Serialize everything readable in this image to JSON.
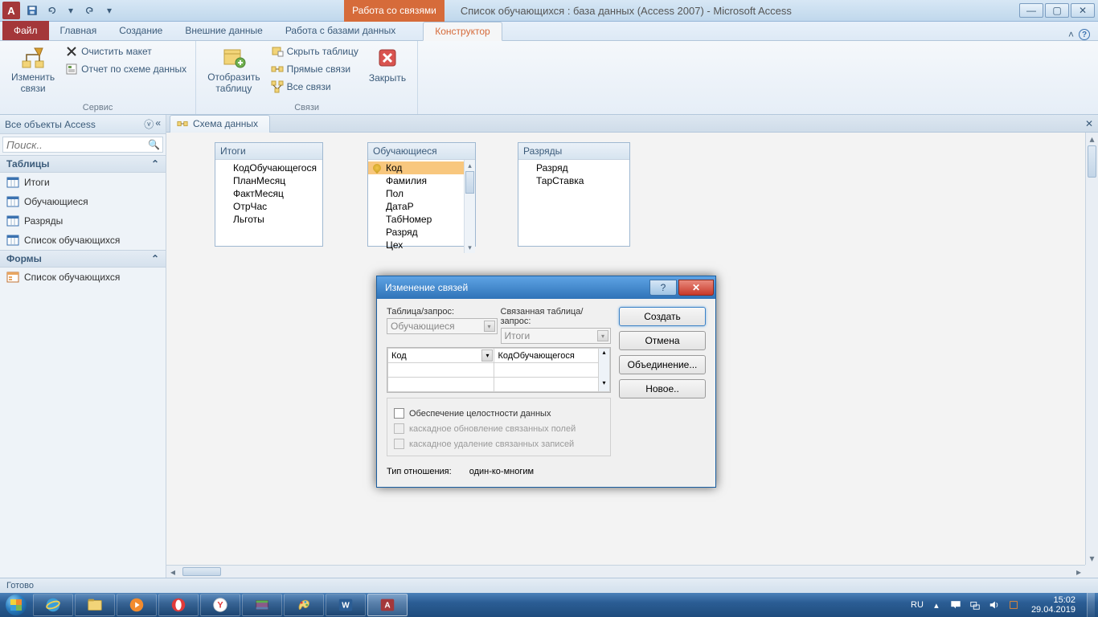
{
  "titlebar": {
    "context_label": "Работа со связями",
    "window_title": "Список обучающихся : база данных (Access 2007)  -  Microsoft Access"
  },
  "ribbon_tabs": {
    "file": "Файл",
    "tabs": [
      "Главная",
      "Создание",
      "Внешние данные",
      "Работа с базами данных"
    ],
    "active": "Конструктор"
  },
  "ribbon": {
    "group1": {
      "edit_rel": "Изменить\nсвязи",
      "clear_layout": "Очистить макет",
      "report": "Отчет по схеме данных",
      "label": "Сервис"
    },
    "group2": {
      "show_table": "Отобразить\nтаблицу",
      "hide_table": "Скрыть таблицу",
      "direct_rel": "Прямые связи",
      "all_rel": "Все связи",
      "close": "Закрыть",
      "label": "Связи"
    }
  },
  "navpane": {
    "header": "Все объекты Access",
    "search_placeholder": "Поиск..",
    "groups": {
      "tables": {
        "label": "Таблицы",
        "items": [
          "Итоги",
          "Обучающиеся",
          "Разряды",
          "Список обучающихся"
        ]
      },
      "forms": {
        "label": "Формы",
        "items": [
          "Список обучающихся"
        ]
      }
    }
  },
  "document": {
    "tab_title": "Схема данных",
    "tables": {
      "t1": {
        "title": "Итоги",
        "fields": [
          "КодОбучающегося",
          "ПланМесяц",
          "ФактМесяц",
          "ОтрЧас",
          "Льготы"
        ]
      },
      "t2": {
        "title": "Обучающиеся",
        "key": "Код",
        "fields": [
          "Фамилия",
          "Пол",
          "ДатаР",
          "ТабНомер",
          "Разряд",
          "Цех"
        ]
      },
      "t3": {
        "title": "Разряды",
        "fields": [
          "Разряд",
          "ТарСтавка"
        ]
      }
    }
  },
  "dialog": {
    "title": "Изменение связей",
    "lbl_table": "Таблица/запрос:",
    "lbl_related": "Связанная таблица/запрос:",
    "combo_left": "Обучающиеся",
    "combo_right": "Итоги",
    "field_left": "Код",
    "field_right": "КодОбучающегося",
    "chk_integrity": "Обеспечение целостности данных",
    "chk_cascade_upd": "каскадное обновление связанных полей",
    "chk_cascade_del": "каскадное удаление связанных записей",
    "lbl_reltype": "Тип отношения:",
    "val_reltype": "один-ко-многим",
    "btn_create": "Создать",
    "btn_cancel": "Отмена",
    "btn_join": "Объединение...",
    "btn_new": "Новое.."
  },
  "statusbar": {
    "text": "Готово"
  },
  "taskbar": {
    "lang": "RU",
    "time": "15:02",
    "date": "29.04.2019"
  }
}
